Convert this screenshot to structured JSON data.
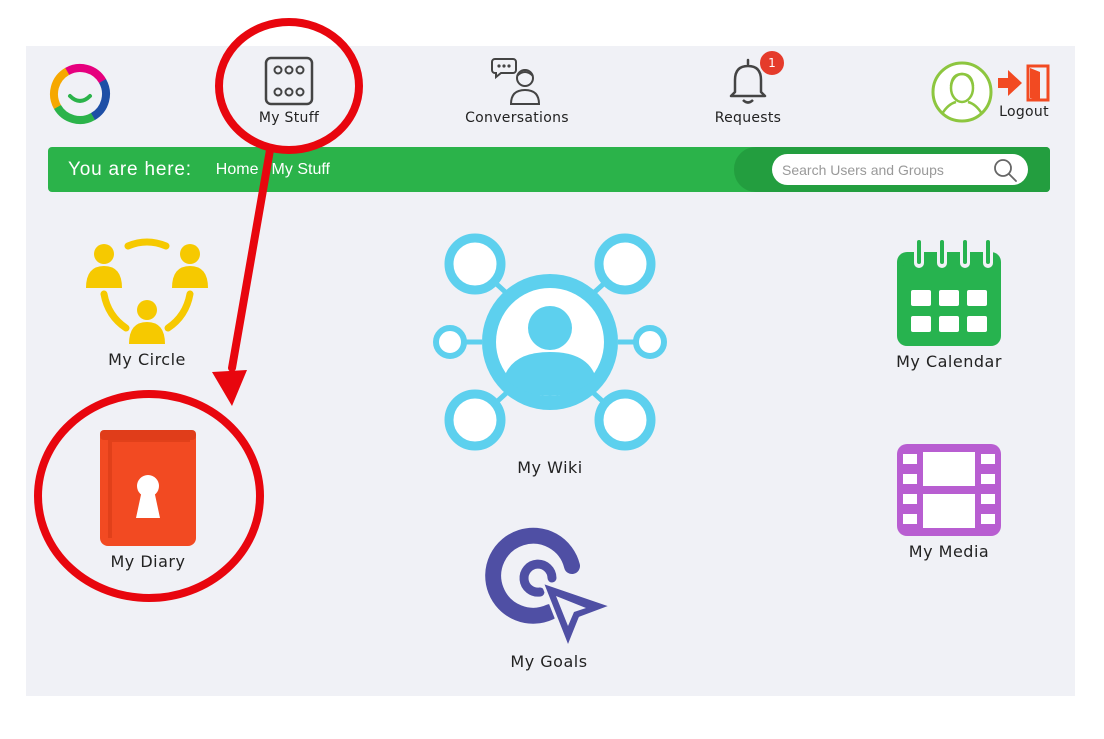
{
  "header": {
    "nav": [
      {
        "id": "my-stuff",
        "label": "My Stuff",
        "icon": "grid-dots-icon"
      },
      {
        "id": "conversations",
        "label": "Conversations",
        "icon": "chat-person-icon"
      },
      {
        "id": "requests",
        "label": "Requests",
        "icon": "bell-icon",
        "badge": "1"
      }
    ],
    "logout_label": "Logout"
  },
  "breadcrumb": {
    "label": "You are here:",
    "items": [
      "Home",
      "My Stuff"
    ],
    "separator": "/"
  },
  "search": {
    "placeholder": "Search Users and Groups"
  },
  "tiles": {
    "my_circle": "My Circle",
    "my_wiki": "My Wiki",
    "my_calendar": "My Calendar",
    "my_diary": "My Diary",
    "my_media": "My Media",
    "my_goals": "My Goals"
  },
  "colors": {
    "green": "#2bb34a",
    "circle": "#f6c900",
    "wiki": "#5dd0ee",
    "calendar": "#27b34f",
    "diary": "#f24a22",
    "media": "#b85ed1",
    "goals": "#4f4fa4",
    "annotation": "#e8060e"
  }
}
